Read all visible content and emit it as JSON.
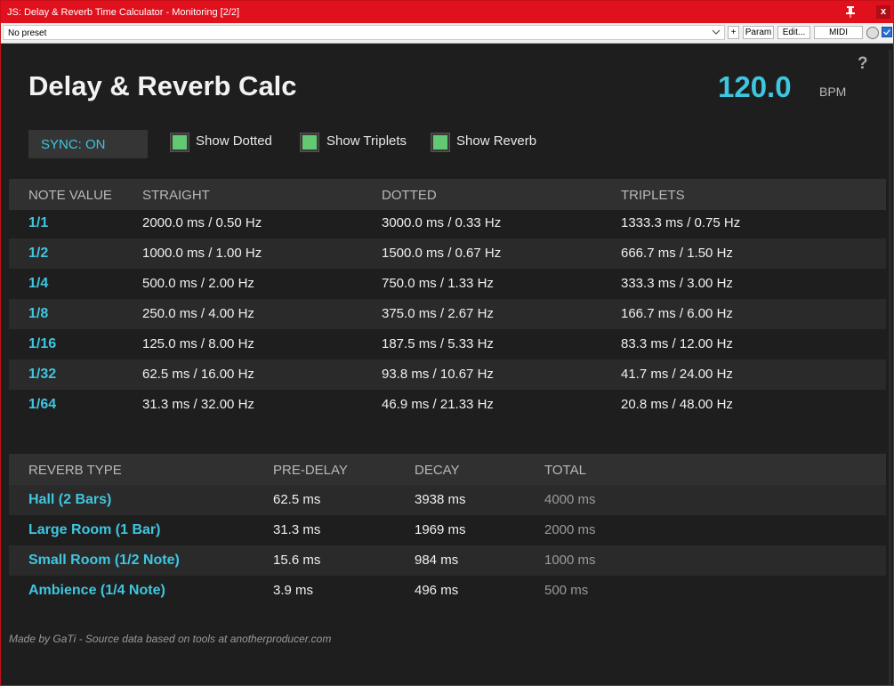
{
  "window": {
    "title": "JS: Delay & Reverb Time Calculator - Monitoring [2/2]",
    "close_label": "x"
  },
  "toolbar": {
    "preset_value": "No preset",
    "plus_label": "+",
    "param_label": "Param",
    "edit_label": "Edit...",
    "midi_label": "MIDI"
  },
  "header": {
    "title": "Delay & Reverb Calc",
    "bpm_value": "120.0",
    "bpm_unit": "BPM",
    "help_label": "?"
  },
  "controls": {
    "sync_label": "SYNC: ON",
    "checkboxes": [
      {
        "label": "Show Dotted",
        "checked": true
      },
      {
        "label": "Show Triplets",
        "checked": true
      },
      {
        "label": "Show Reverb",
        "checked": true
      }
    ]
  },
  "delay_table": {
    "columns": [
      "NOTE VALUE",
      "STRAIGHT",
      "DOTTED",
      "TRIPLETS"
    ],
    "rows": [
      {
        "note": "1/1",
        "straight": "2000.0 ms / 0.50 Hz",
        "dotted": "3000.0 ms / 0.33 Hz",
        "triplets": "1333.3 ms / 0.75 Hz"
      },
      {
        "note": "1/2",
        "straight": "1000.0 ms / 1.00 Hz",
        "dotted": "1500.0 ms / 0.67 Hz",
        "triplets": "666.7 ms / 1.50 Hz"
      },
      {
        "note": "1/4",
        "straight": "500.0 ms / 2.00 Hz",
        "dotted": "750.0 ms / 1.33 Hz",
        "triplets": "333.3 ms / 3.00 Hz"
      },
      {
        "note": "1/8",
        "straight": "250.0 ms / 4.00 Hz",
        "dotted": "375.0 ms / 2.67 Hz",
        "triplets": "166.7 ms / 6.00 Hz"
      },
      {
        "note": "1/16",
        "straight": "125.0 ms / 8.00 Hz",
        "dotted": "187.5 ms / 5.33 Hz",
        "triplets": "83.3 ms / 12.00 Hz"
      },
      {
        "note": "1/32",
        "straight": "62.5 ms / 16.00 Hz",
        "dotted": "93.8 ms / 10.67 Hz",
        "triplets": "41.7 ms / 24.00 Hz"
      },
      {
        "note": "1/64",
        "straight": "31.3 ms / 32.00 Hz",
        "dotted": "46.9 ms / 21.33 Hz",
        "triplets": "20.8 ms / 48.00 Hz"
      }
    ]
  },
  "reverb_table": {
    "columns": [
      "REVERB TYPE",
      "PRE-DELAY",
      "DECAY",
      "TOTAL"
    ],
    "rows": [
      {
        "type": "Hall (2 Bars)",
        "predelay": "62.5 ms",
        "decay": "3938 ms",
        "total": "4000 ms"
      },
      {
        "type": "Large Room (1 Bar)",
        "predelay": "31.3 ms",
        "decay": "1969 ms",
        "total": "2000 ms"
      },
      {
        "type": "Small Room (1/2 Note)",
        "predelay": "15.6 ms",
        "decay": "984 ms",
        "total": "1000 ms"
      },
      {
        "type": "Ambience (1/4 Note)",
        "predelay": "3.9 ms",
        "decay": "496 ms",
        "total": "500 ms"
      }
    ]
  },
  "footer": {
    "text": "Made by GaTi - Source data based on tools at anotherproducer.com"
  },
  "colors": {
    "accent": "#3ec6e0",
    "titlebar": "#e0101c",
    "checkbox": "#63c872",
    "background": "#1e1e1e"
  },
  "icons": {
    "pin": "pin-icon",
    "close": "close-icon",
    "dropdown": "chevron-down-icon",
    "knob": "knob-icon",
    "checkbox": "checkbox-icon"
  }
}
